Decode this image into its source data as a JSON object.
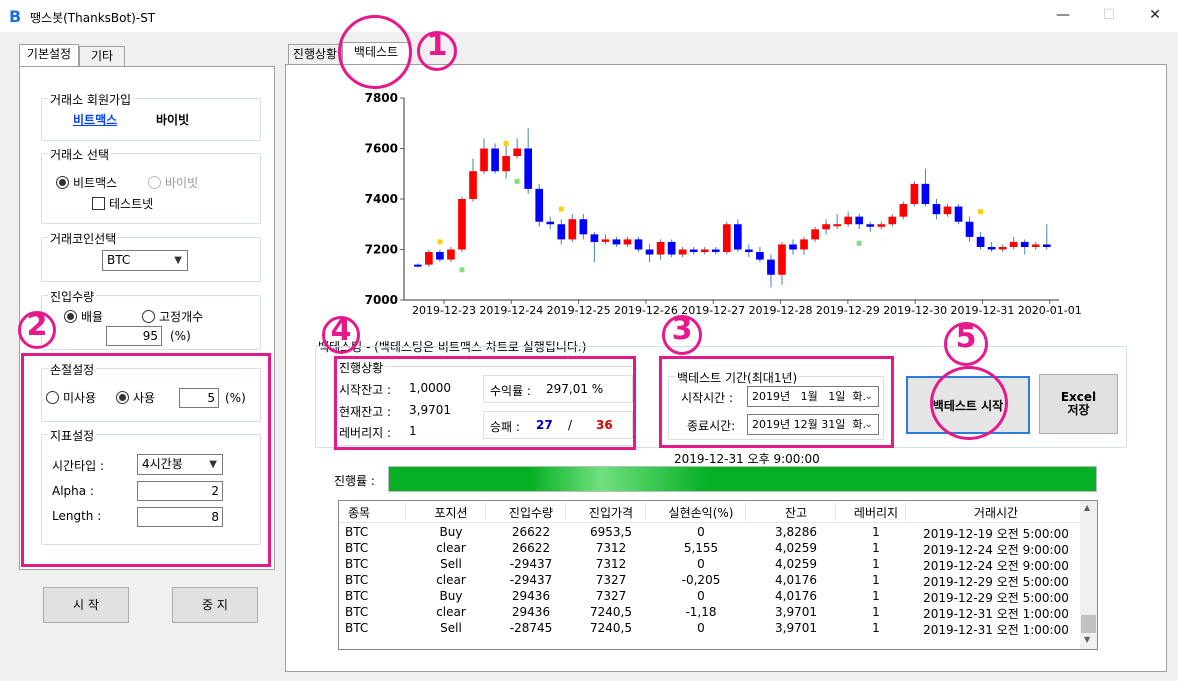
{
  "window": {
    "title": "땡스봇(ThanksBot)-ST",
    "icon": "B",
    "minimize": "—",
    "maximize": "☐",
    "close": "✕"
  },
  "left_tabs": [
    "기본설정",
    "기타"
  ],
  "signup": {
    "title": "거래소 회원가입",
    "link1": "비트맥스",
    "link2": "바이빗"
  },
  "exchange": {
    "title": "거래소 선택",
    "opt1": "비트맥스",
    "opt2": "바이빗",
    "testnet": "테스트넷"
  },
  "coin": {
    "title": "거래코인선택",
    "value": "BTC"
  },
  "entry": {
    "title": "진입수량",
    "opt1": "배율",
    "opt2": "고정개수",
    "value": "95",
    "unit": "(%)"
  },
  "stoploss": {
    "title": "손절설정",
    "opt1": "미사용",
    "opt2": "사용",
    "value": "5",
    "unit": "(%)"
  },
  "indicator": {
    "title": "지표설정",
    "timetype_label": "시간타입 :",
    "timetype_value": "4시간봉",
    "alpha_label": "Alpha :",
    "alpha_value": "2",
    "length_label": "Length :",
    "length_value": "8"
  },
  "buttons": {
    "start": "시 작",
    "stop": "중 지",
    "backtest_start": "백테스트 시작",
    "excel": "Excel\n저장"
  },
  "main_tabs": [
    "진행상황",
    "백테스트"
  ],
  "backtest_note": "백테스팅 - (백테스팅은 비트맥스 차트로 실행됩니다.)",
  "status": {
    "title": "진행상황",
    "start_balance_label": "시작잔고 :",
    "start_balance": "1,0000",
    "current_balance_label": "현재잔고 :",
    "current_balance": "3,9701",
    "leverage_label": "레버리지 :",
    "leverage": "1",
    "return_label": "수익률 :",
    "return_value": "297,01 %",
    "winloss_label": "승패 :",
    "wins": "27",
    "sep": "/",
    "losses": "36"
  },
  "period": {
    "title": "백테스트 기간(최대1년)",
    "start_label": "시작시간 :",
    "start_value": "2019년   1월   1일  화.",
    "end_label": "종료시간:",
    "end_value": "2019년 12월 31일  화."
  },
  "progress": {
    "timestamp": "2019-12-31 오후 9:00:00",
    "label": "진행률 :",
    "fraction": 1.0
  },
  "annotations": [
    "1",
    "2",
    "3",
    "4",
    "5"
  ],
  "table": {
    "columns": [
      "종목",
      "포지션",
      "진입수량",
      "진입가격",
      "실현손익(%)",
      "잔고",
      "레버리지",
      "거래시간"
    ],
    "rows": [
      [
        "BTC",
        "Buy",
        "26622",
        "6953,5",
        "0",
        "3,8286",
        "1",
        "2019-12-19 오전 5:00:00"
      ],
      [
        "BTC",
        "clear",
        "26622",
        "7312",
        "5,155",
        "4,0259",
        "1",
        "2019-12-24 오전 9:00:00"
      ],
      [
        "BTC",
        "Sell",
        "-29437",
        "7312",
        "0",
        "4,0259",
        "1",
        "2019-12-24 오전 9:00:00"
      ],
      [
        "BTC",
        "clear",
        "-29437",
        "7327",
        "-0,205",
        "4,0176",
        "1",
        "2019-12-29 오전 5:00:00"
      ],
      [
        "BTC",
        "Buy",
        "29436",
        "7327",
        "0",
        "4,0176",
        "1",
        "2019-12-29 오전 5:00:00"
      ],
      [
        "BTC",
        "clear",
        "29436",
        "7240,5",
        "-1,18",
        "3,9701",
        "1",
        "2019-12-31 오전 1:00:00"
      ],
      [
        "BTC",
        "Sell",
        "-28745",
        "7240,5",
        "0",
        "3,9701",
        "1",
        "2019-12-31 오전 1:00:00"
      ]
    ]
  },
  "chart_data": {
    "type": "candlestick",
    "ylim": [
      7000,
      7800
    ],
    "yticks": [
      "7000",
      "7200",
      "7400",
      "7600",
      "7800"
    ],
    "xticks": [
      "2019-12-23",
      "2019-12-24",
      "2019-12-25",
      "2019-12-26",
      "2019-12-27",
      "2019-12-28",
      "2019-12-29",
      "2019-12-30",
      "2019-12-31",
      "2020-01-01"
    ],
    "up_color": "#ff0000",
    "down_color": "#0000ff",
    "candles": [
      [
        7140,
        7135,
        7145,
        7130
      ],
      [
        7140,
        7190,
        7200,
        7130
      ],
      [
        7190,
        7160,
        7200,
        7150
      ],
      [
        7160,
        7200,
        7210,
        7150
      ],
      [
        7200,
        7400,
        7410,
        7190
      ],
      [
        7400,
        7510,
        7560,
        7390
      ],
      [
        7510,
        7600,
        7640,
        7500
      ],
      [
        7600,
        7510,
        7620,
        7500
      ],
      [
        7510,
        7570,
        7610,
        7480
      ],
      [
        7570,
        7600,
        7640,
        7560
      ],
      [
        7600,
        7440,
        7680,
        7420
      ],
      [
        7440,
        7310,
        7460,
        7290
      ],
      [
        7310,
        7300,
        7330,
        7280
      ],
      [
        7300,
        7240,
        7320,
        7220
      ],
      [
        7240,
        7320,
        7340,
        7230
      ],
      [
        7320,
        7260,
        7340,
        7240
      ],
      [
        7260,
        7230,
        7270,
        7150
      ],
      [
        7230,
        7240,
        7260,
        7220
      ],
      [
        7240,
        7220,
        7250,
        7210
      ],
      [
        7220,
        7240,
        7250,
        7210
      ],
      [
        7240,
        7200,
        7250,
        7190
      ],
      [
        7200,
        7180,
        7220,
        7150
      ],
      [
        7180,
        7230,
        7240,
        7160
      ],
      [
        7230,
        7180,
        7240,
        7170
      ],
      [
        7180,
        7200,
        7210,
        7170
      ],
      [
        7200,
        7190,
        7210,
        7180
      ],
      [
        7190,
        7200,
        7210,
        7180
      ],
      [
        7200,
        7190,
        7210,
        7180
      ],
      [
        7190,
        7300,
        7310,
        7180
      ],
      [
        7300,
        7200,
        7320,
        7190
      ],
      [
        7200,
        7190,
        7220,
        7170
      ],
      [
        7190,
        7160,
        7210,
        7150
      ],
      [
        7160,
        7100,
        7180,
        7050
      ],
      [
        7100,
        7220,
        7230,
        7060
      ],
      [
        7220,
        7200,
        7240,
        7180
      ],
      [
        7200,
        7240,
        7250,
        7180
      ],
      [
        7240,
        7280,
        7290,
        7230
      ],
      [
        7280,
        7300,
        7320,
        7260
      ],
      [
        7300,
        7300,
        7340,
        7280
      ],
      [
        7300,
        7330,
        7350,
        7290
      ],
      [
        7330,
        7300,
        7340,
        7280
      ],
      [
        7300,
        7290,
        7310,
        7270
      ],
      [
        7290,
        7300,
        7310,
        7280
      ],
      [
        7300,
        7330,
        7340,
        7290
      ],
      [
        7330,
        7380,
        7390,
        7320
      ],
      [
        7380,
        7460,
        7470,
        7370
      ],
      [
        7460,
        7380,
        7520,
        7370
      ],
      [
        7380,
        7340,
        7400,
        7320
      ],
      [
        7340,
        7370,
        7380,
        7330
      ],
      [
        7370,
        7310,
        7380,
        7300
      ],
      [
        7310,
        7250,
        7330,
        7230
      ],
      [
        7250,
        7210,
        7270,
        7200
      ],
      [
        7210,
        7200,
        7230,
        7190
      ],
      [
        7200,
        7210,
        7220,
        7190
      ],
      [
        7210,
        7230,
        7250,
        7200
      ],
      [
        7230,
        7210,
        7240,
        7180
      ],
      [
        7210,
        7220,
        7230,
        7200
      ],
      [
        7220,
        7210,
        7300,
        7200
      ]
    ],
    "markers": [
      {
        "index": 2,
        "price": 7230,
        "color": "#ffd000"
      },
      {
        "index": 4,
        "price": 7120,
        "color": "#80e080"
      },
      {
        "index": 8,
        "price": 7620,
        "color": "#ffd000"
      },
      {
        "index": 9,
        "price": 7470,
        "color": "#80e080"
      },
      {
        "index": 13,
        "price": 7360,
        "color": "#ffd000"
      },
      {
        "index": 40,
        "price": 7225,
        "color": "#80e080"
      },
      {
        "index": 51,
        "price": 7350,
        "color": "#ffd000"
      }
    ]
  }
}
